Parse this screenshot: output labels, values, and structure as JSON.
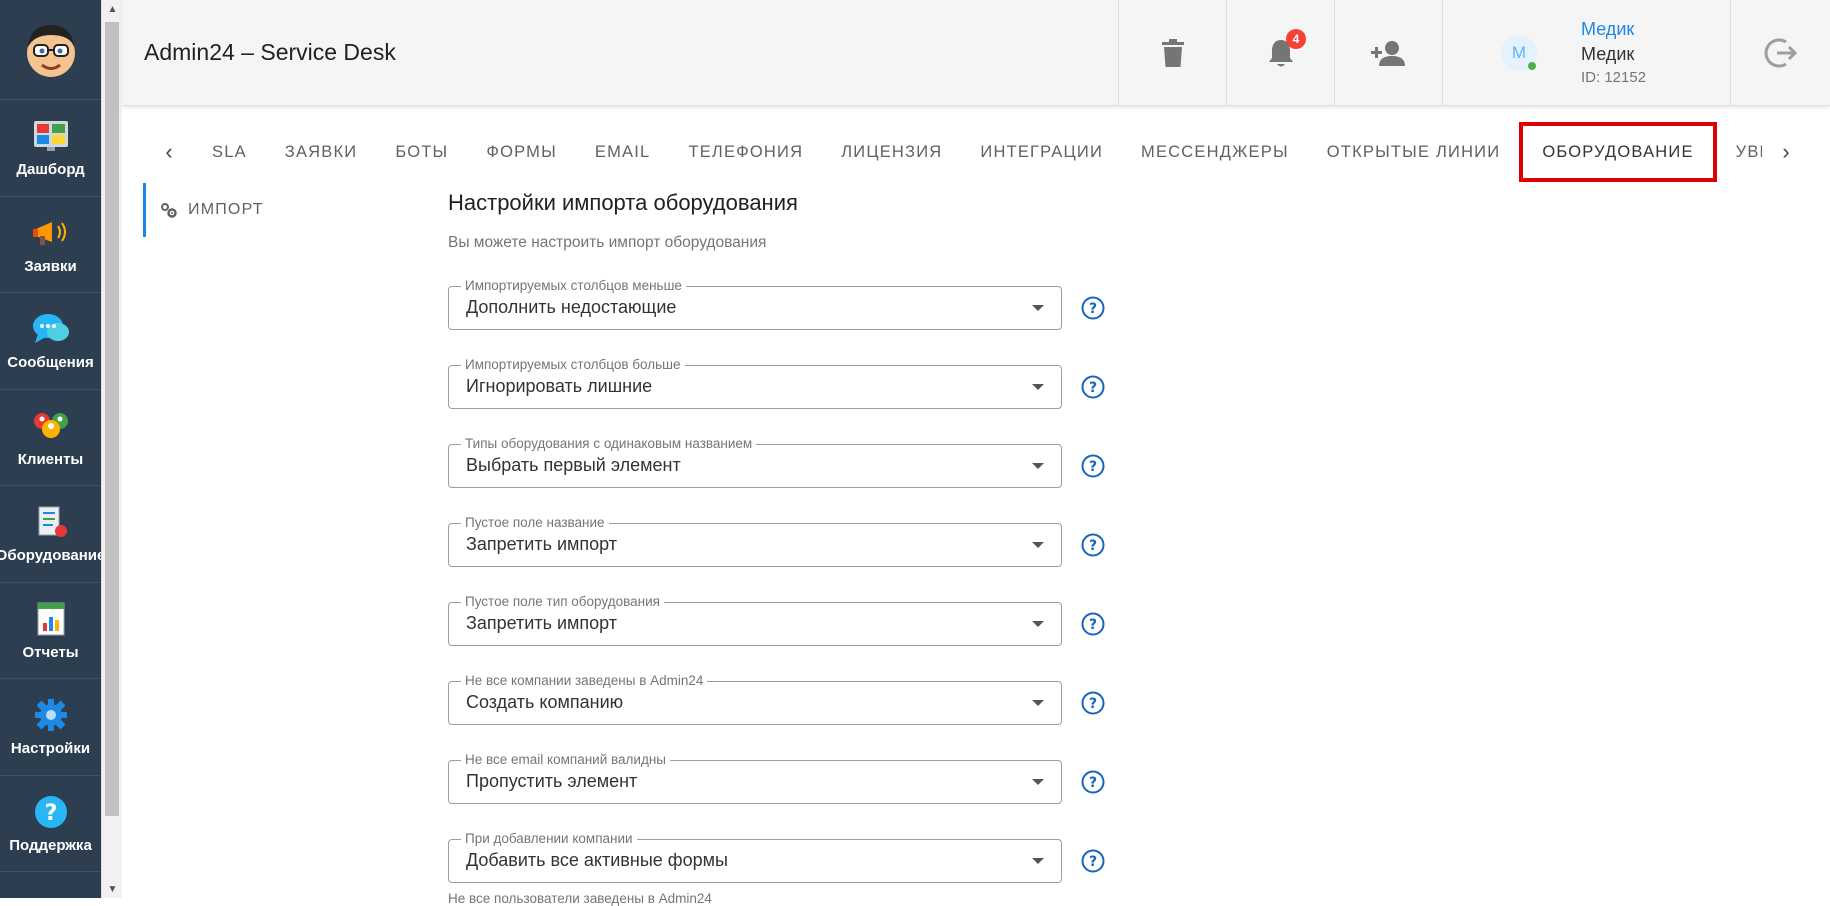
{
  "app": {
    "title": "Admin24 – Service Desk"
  },
  "sidebar": {
    "items": [
      {
        "label": "Дашборд",
        "icon": "dashboard-icon"
      },
      {
        "label": "Заявки",
        "icon": "megaphone-icon"
      },
      {
        "label": "Сообщения",
        "icon": "chat-bubble-icon"
      },
      {
        "label": "Клиенты",
        "icon": "clients-icon"
      },
      {
        "label": "Оборудование",
        "icon": "equipment-icon"
      },
      {
        "label": "Отчеты",
        "icon": "report-icon"
      },
      {
        "label": "Настройки",
        "icon": "gear-icon"
      },
      {
        "label": "Поддержка",
        "icon": "question-icon"
      }
    ]
  },
  "header": {
    "notification_count": "4",
    "user": {
      "link": "Медик",
      "name": "Медик",
      "id": "ID: 12152",
      "avatar_letter": "M"
    }
  },
  "tabs": {
    "items": [
      "SLA",
      "ЗАЯВКИ",
      "БОТЫ",
      "ФОРМЫ",
      "EMAIL",
      "ТЕЛЕФОНИЯ",
      "ЛИЦЕНЗИЯ",
      "ИНТЕГРАЦИИ",
      "МЕССЕНДЖЕРЫ",
      "ОТКРЫТЫЕ ЛИНИИ",
      "ОБОРУДОВАНИЕ",
      "УВЕДОМЛЕНИЯ"
    ],
    "active": "ОБОРУДОВАНИЕ"
  },
  "submenu": {
    "label": "ИМПОРТ"
  },
  "form": {
    "title": "Настройки импорта оборудования",
    "subtitle": "Вы можете настроить импорт оборудования",
    "fields": [
      {
        "label": "Импортируемых столбцов меньше",
        "value": "Дополнить недостающие"
      },
      {
        "label": "Импортируемых столбцов больше",
        "value": "Игнорировать лишние"
      },
      {
        "label": "Типы оборудования с одинаковым названием",
        "value": "Выбрать первый элемент"
      },
      {
        "label": "Пустое поле название",
        "value": "Запретить импорт"
      },
      {
        "label": "Пустое поле тип оборудования",
        "value": "Запретить импорт"
      },
      {
        "label": "Не все компании заведены в Admin24",
        "value": "Создать компанию"
      },
      {
        "label": "Не все email компаний валидны",
        "value": "Пропустить элемент"
      },
      {
        "label": "При добавлении компании",
        "value": "Добавить все активные формы"
      }
    ],
    "cut_label": "Не все пользователи заведены в Admin24"
  },
  "colors": {
    "sidebar_bg": "#2c3e50",
    "accent": "#1e88e5",
    "highlight": "#e00000",
    "badge": "#f44336"
  }
}
